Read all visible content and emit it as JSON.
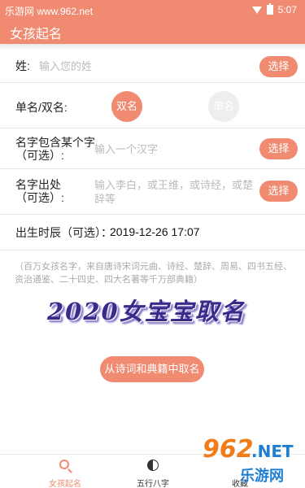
{
  "statusbar": {
    "watermark": "乐游网 www.962.net",
    "time": "5:07"
  },
  "appbar": {
    "title": "女孩起名"
  },
  "form": {
    "surname": {
      "label": "姓:",
      "placeholder": "输入您的姓",
      "button": "选择"
    },
    "name_type": {
      "label": "单名/双名:",
      "option_double": "双名",
      "option_single": "单名"
    },
    "contains_char": {
      "label_line1": "名字包含某个字",
      "label_line2": "（可选）:",
      "placeholder": "输入一个汉字",
      "button": "选择"
    },
    "source": {
      "label_line1": "名字出处",
      "label_line2": "（可选）:",
      "placeholder": "输入李白，或王维，或诗经，或楚辞等",
      "button": "选择"
    },
    "birth": {
      "label": "出生时辰（可选）：",
      "value": "2019-12-26 17:07"
    }
  },
  "note": "（百万女孩名字，来自唐诗宋词元曲、诗经、楚辞、周易、四书五经、资治通鉴、二十四史、四大名著等千万部典籍）",
  "banner": "2020女宝宝取名",
  "main_button": "从诗词和典籍中取名",
  "bottom_nav": [
    {
      "label": "女孩起名",
      "icon": "search-icon",
      "active": true
    },
    {
      "label": "五行八字",
      "icon": "yinyang-icon",
      "active": false
    },
    {
      "label": "收藏",
      "icon": "star-icon",
      "active": false
    }
  ],
  "overlay_watermark": {
    "number": "962",
    "suffix": ".NET",
    "chinese": "乐游网"
  },
  "colors": {
    "accent": "#f08a70",
    "inactive_circle": "#eeeeee",
    "placeholder": "#bbbbbb"
  }
}
